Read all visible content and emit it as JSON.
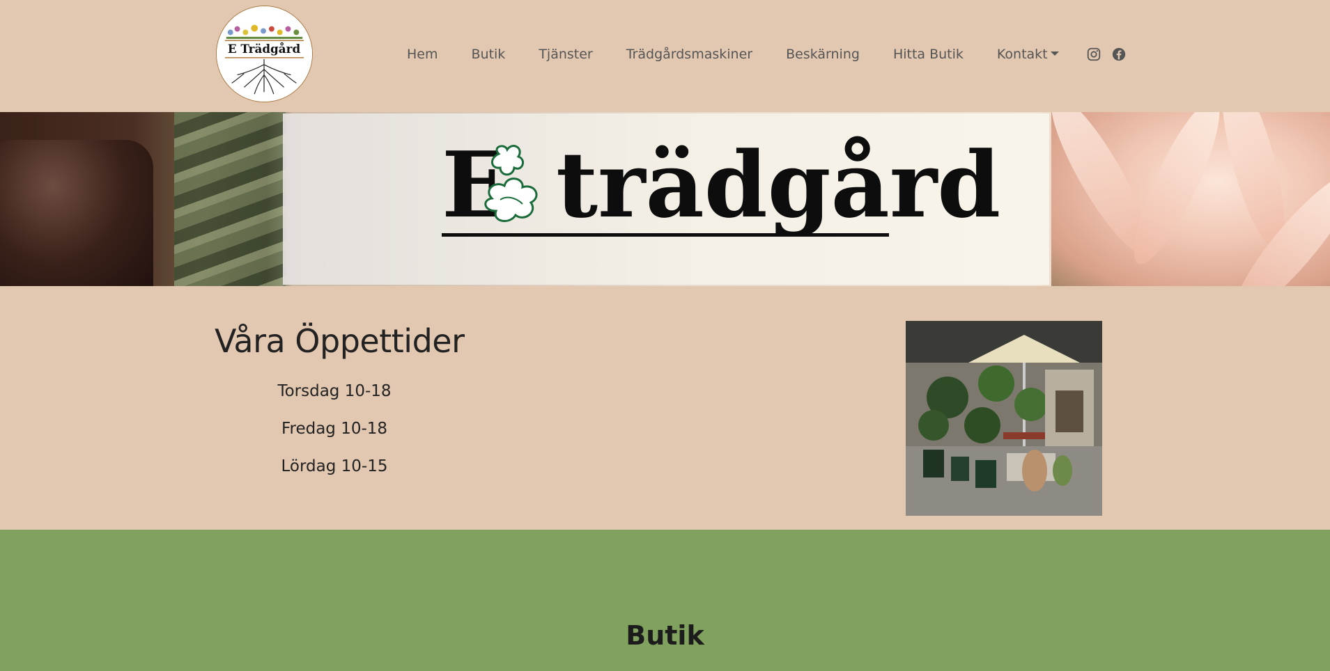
{
  "header": {
    "logo_text": "E Trädgård",
    "nav": [
      {
        "label": "Hem"
      },
      {
        "label": "Butik"
      },
      {
        "label": "Tjänster"
      },
      {
        "label": "Trädgårdsmaskiner"
      },
      {
        "label": "Beskärning"
      },
      {
        "label": "Hitta Butik"
      },
      {
        "label": "Kontakt"
      }
    ],
    "social_icons": [
      "instagram-icon",
      "facebook-icon"
    ]
  },
  "banner": {
    "title_left": "E",
    "title_right": "trädgård"
  },
  "hours": {
    "title": "Våra Öppettider",
    "lines": [
      "Torsdag 10-18",
      "Fredag 10-18",
      "Lördag 10-15"
    ]
  },
  "butik": {
    "title": "Butik"
  },
  "colors": {
    "background": "#e2c7b1",
    "green_section": "#80a25e",
    "nav_text": "#555555"
  }
}
